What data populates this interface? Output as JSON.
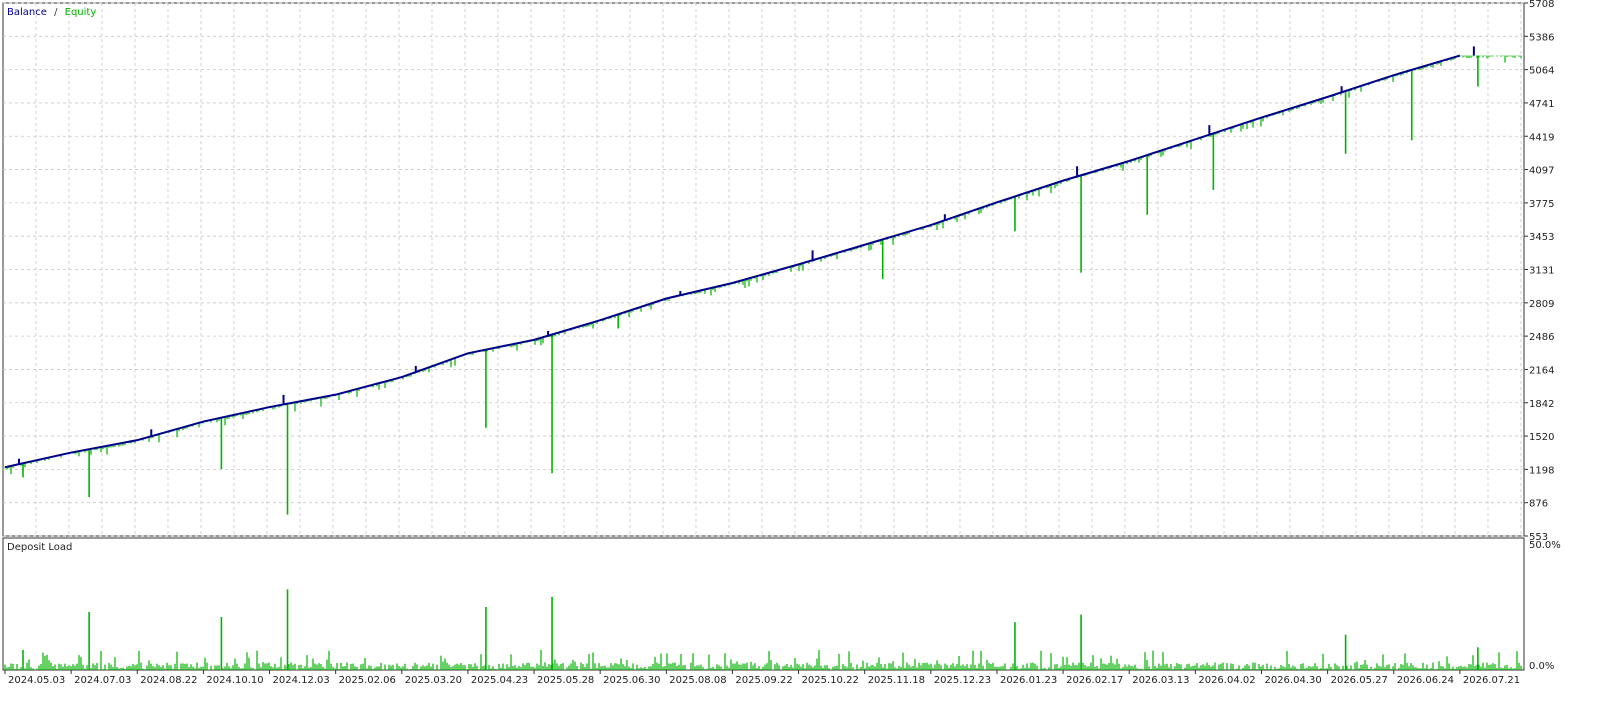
{
  "legend": {
    "balance_label": "Balance",
    "separator": "/",
    "equity_label": "Equity"
  },
  "colors": {
    "balance": "#00008b",
    "equity": "#00b400",
    "grid": "#c8c8c8",
    "frame": "#333333",
    "background": "#ffffff"
  },
  "chart_data": [
    {
      "type": "line",
      "title": "",
      "series": [
        {
          "name": "Balance",
          "color": "#00008b"
        },
        {
          "name": "Equity",
          "color": "#00b400"
        }
      ],
      "x": [
        "2024.05.03",
        "2024.07.03",
        "2024.08.22",
        "2024.10.10",
        "2024.12.03",
        "2025.02.06",
        "2025.03.20",
        "2025.04.23",
        "2025.05.28",
        "2025.06.30",
        "2025.08.08",
        "2025.09.22",
        "2025.10.22",
        "2025.11.18",
        "2025.12.23",
        "2026.01.23",
        "2026.02.17",
        "2026.03.13",
        "2026.04.02",
        "2026.04.30",
        "2026.05.27",
        "2026.06.24",
        "2026.07.21"
      ],
      "balance": [
        1218,
        1360,
        1480,
        1660,
        1800,
        1920,
        2090,
        2320,
        2450,
        2640,
        2850,
        3000,
        3180,
        3370,
        3560,
        3780,
        3990,
        4180,
        4390,
        4600,
        4800,
        5010,
        5200
      ],
      "equity_dips": [
        {
          "x": "2024.05.03",
          "low": 1120
        },
        {
          "x": "2024.07.03",
          "low": 930
        },
        {
          "x": "2024.10.10",
          "low": 1200
        },
        {
          "x": "2024.12.03",
          "low": 760
        },
        {
          "x": "2025.04.23",
          "low": 1600
        },
        {
          "x": "2025.05.28",
          "low": 1160
        },
        {
          "x": "2025.06.30",
          "low": 2560
        },
        {
          "x": "2025.11.18",
          "low": 3040
        },
        {
          "x": "2026.01.23",
          "low": 3500
        },
        {
          "x": "2026.02.17",
          "low": 3100
        },
        {
          "x": "2026.03.13",
          "low": 3660
        },
        {
          "x": "2026.04.02",
          "low": 3900
        },
        {
          "x": "2026.05.27",
          "low": 4250
        },
        {
          "x": "2026.06.24",
          "low": 4380
        },
        {
          "x": "2026.07.21",
          "low": 4900
        }
      ],
      "ylim": [
        553,
        5708
      ],
      "y_ticks": [
        "5708",
        "5386",
        "5064",
        "4741",
        "4419",
        "4097",
        "3775",
        "3453",
        "3131",
        "2809",
        "2486",
        "2164",
        "1842",
        "1520",
        "1198",
        "876",
        "553"
      ],
      "grid": true,
      "legend_position": "top-left"
    },
    {
      "type": "bar",
      "title": "Deposit Load",
      "series": [
        {
          "name": "Deposit Load",
          "color": "#00b400"
        }
      ],
      "x": [
        "2024.05.03",
        "2024.07.03",
        "2024.08.22",
        "2024.10.10",
        "2024.12.03",
        "2025.02.06",
        "2025.03.20",
        "2025.04.23",
        "2025.05.28",
        "2025.06.30",
        "2025.08.08",
        "2025.09.22",
        "2025.10.22",
        "2025.11.18",
        "2025.12.23",
        "2026.01.23",
        "2026.02.17",
        "2026.03.13",
        "2026.04.02",
        "2026.04.30",
        "2026.05.27",
        "2026.06.24",
        "2026.07.21"
      ],
      "peaks": [
        {
          "x": "2024.05.03",
          "value": 0.08
        },
        {
          "x": "2024.07.03",
          "value": 0.23
        },
        {
          "x": "2024.10.10",
          "value": 0.21
        },
        {
          "x": "2024.12.03",
          "value": 0.32
        },
        {
          "x": "2025.04.23",
          "value": 0.25
        },
        {
          "x": "2025.05.28",
          "value": 0.29
        },
        {
          "x": "2026.01.23",
          "value": 0.19
        },
        {
          "x": "2026.02.17",
          "value": 0.22
        },
        {
          "x": "2026.05.27",
          "value": 0.14
        },
        {
          "x": "2026.07.21",
          "value": 0.09
        }
      ],
      "ylim": [
        0,
        0.5
      ],
      "y_ticks": [
        "50.0%",
        "0.0%"
      ],
      "grid": false
    }
  ]
}
